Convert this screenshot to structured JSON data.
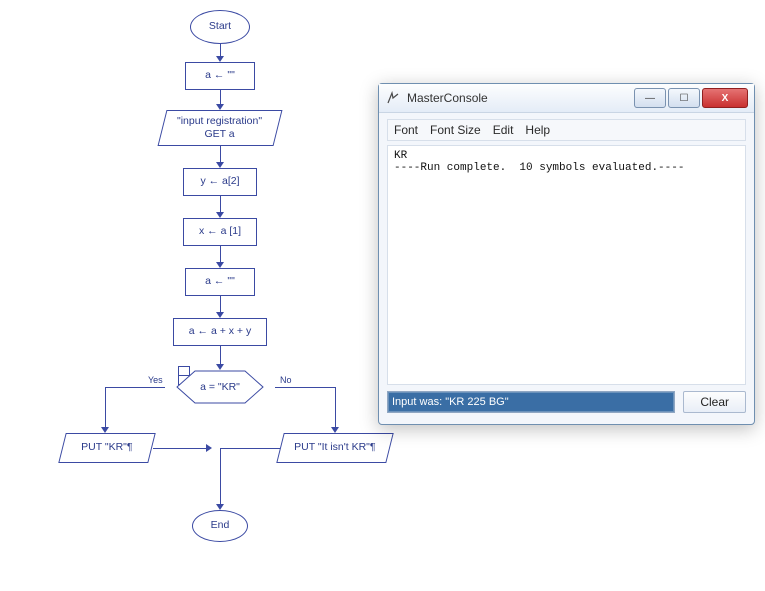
{
  "flow": {
    "start": "Start",
    "end": "End",
    "init_a": "a ← \"\"",
    "input_block": "\"input registration\"\nGET a",
    "y_assign": "y ← a[2]",
    "x_assign": "x ← a [1]",
    "clear_a": "a ← \"\"",
    "concat": "a ← a + x + y",
    "decision": "a = \"KR\"",
    "yes": "Yes",
    "no": "No",
    "put_true": "PUT \"KR\"¶",
    "put_false": "PUT \"It isn't KR\"¶"
  },
  "window": {
    "title": "MasterConsole",
    "menu": {
      "font": "Font",
      "fontsize": "Font Size",
      "edit": "Edit",
      "help": "Help"
    },
    "output_line1": "KR",
    "output_line2": "----Run complete.  10 symbols evaluated.----",
    "input_value": "Input was: \"KR 225 BG\"",
    "clear": "Clear",
    "btn_min": "—",
    "btn_max": "☐",
    "btn_close": "X"
  }
}
